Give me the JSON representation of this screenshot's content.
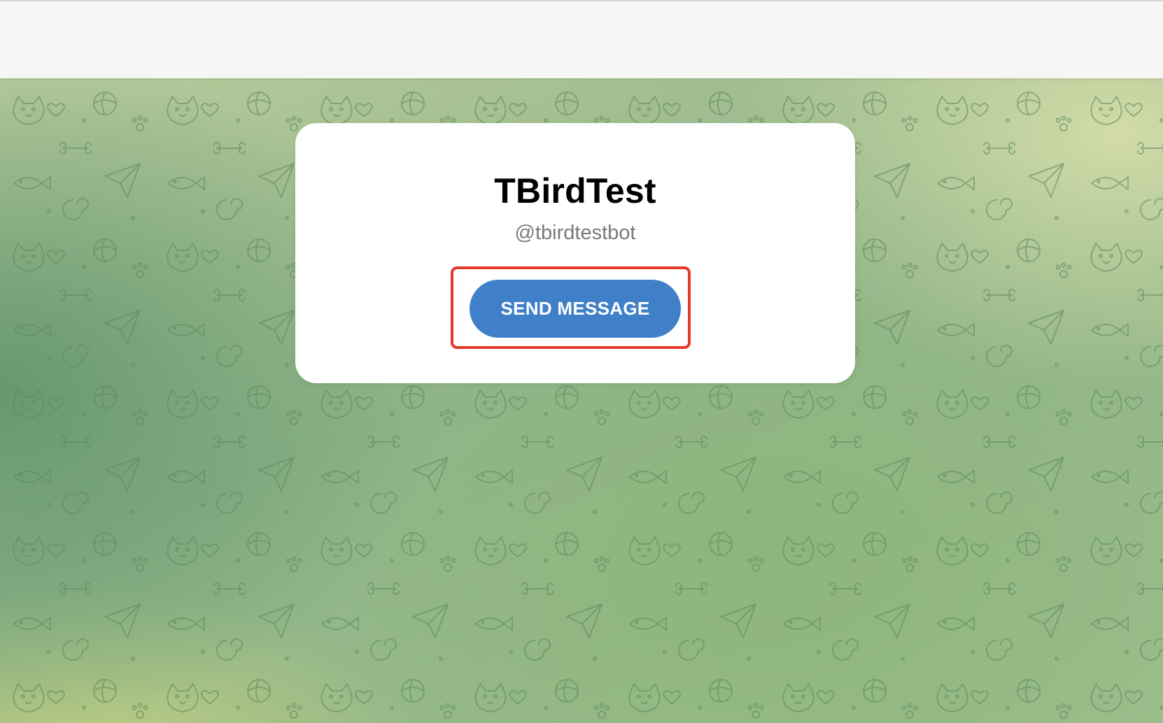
{
  "bot": {
    "name": "TBirdTest",
    "username": "@tbirdtestbot"
  },
  "actions": {
    "send_message_label": "SEND MESSAGE"
  },
  "colors": {
    "button": "#4080c8",
    "highlight": "#e53a2b",
    "card": "#ffffff",
    "background": "#a7c08f"
  },
  "icons": {
    "background_pattern": "doodle-pattern"
  }
}
